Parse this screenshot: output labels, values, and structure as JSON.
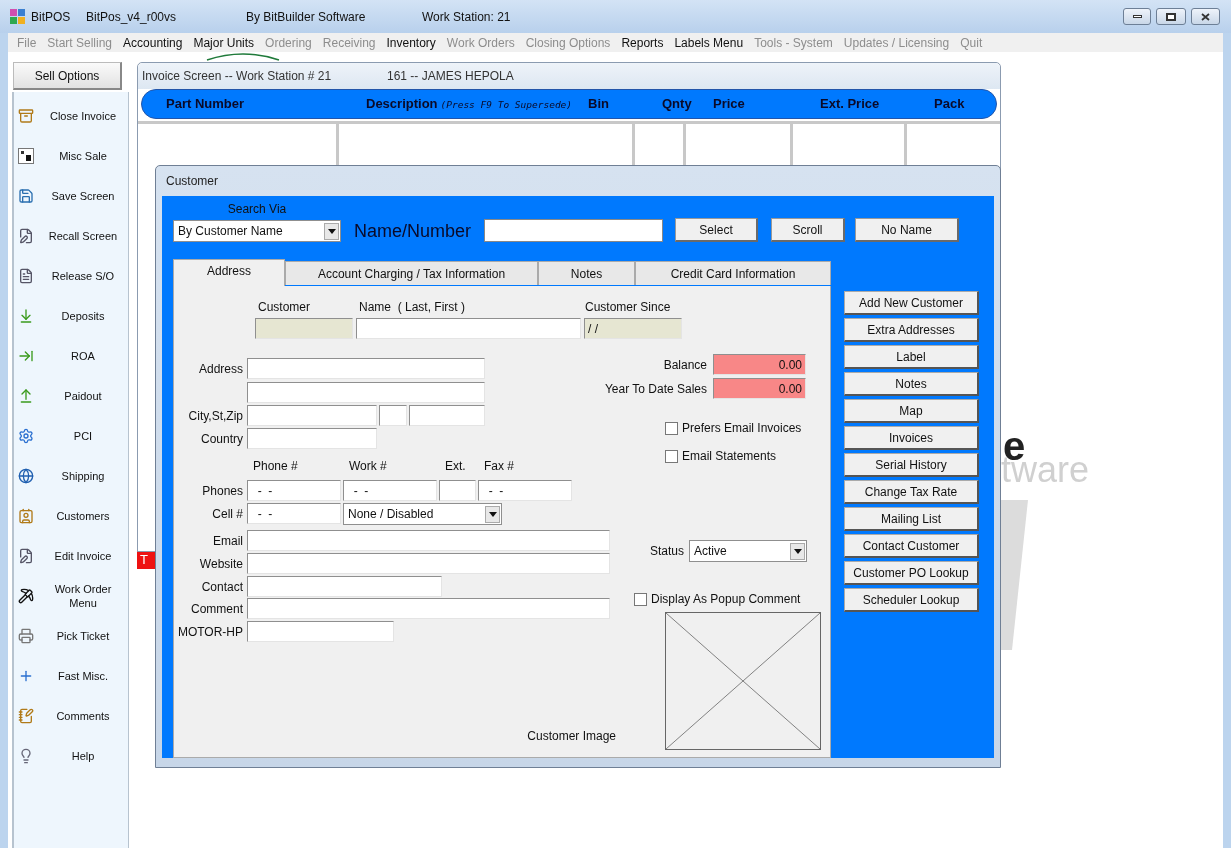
{
  "app_window": {
    "app_name": "BitPOS",
    "version": "BitPos_v4_r00vs",
    "vendor": "By BitBuilder Software",
    "workstation": "Work Station: 21"
  },
  "menu": [
    {
      "label": "File",
      "disabled": true
    },
    {
      "label": "Start Selling",
      "disabled": true
    },
    {
      "label": "Accounting",
      "disabled": false
    },
    {
      "label": "Major Units",
      "disabled": false
    },
    {
      "label": "Ordering",
      "disabled": true
    },
    {
      "label": "Receiving",
      "disabled": true
    },
    {
      "label": "Inventory",
      "disabled": false
    },
    {
      "label": "Work Orders",
      "disabled": true
    },
    {
      "label": "Closing Options",
      "disabled": true
    },
    {
      "label": "Reports",
      "disabled": false
    },
    {
      "label": "Labels Menu",
      "disabled": false
    },
    {
      "label": "Tools - System",
      "disabled": true
    },
    {
      "label": "Updates / Licensing",
      "disabled": true
    },
    {
      "label": "Quit",
      "disabled": true
    }
  ],
  "sidebar": {
    "header": "Sell Options",
    "items": [
      "Close Invoice",
      "Misc Sale",
      "Save Screen",
      "Recall Screen",
      "Release S/O",
      "Deposits",
      "ROA",
      "Paidout",
      "PCI",
      "Shipping",
      "Customers",
      "Edit Invoice",
      "Work Order Menu",
      "Pick Ticket",
      "Fast Misc.",
      "Comments",
      "Help"
    ]
  },
  "background": {
    "logo_text_1": "e",
    "logo_text_2": "tware",
    "tag": "T"
  },
  "invoice_window": {
    "title": "Invoice Screen -- Work Station # 21",
    "customer": "161 -- JAMES HEPOLA",
    "columns": [
      {
        "label": "Part Number"
      },
      {
        "label": "Description",
        "hint": "(Press F9 To Supersede)"
      },
      {
        "label": "Bin"
      },
      {
        "label": "Qnty"
      },
      {
        "label": "Price"
      },
      {
        "label": "Ext. Price"
      },
      {
        "label": "Pack"
      }
    ]
  },
  "customer_dialog": {
    "title": "Customer",
    "search_via_label": "Search Via",
    "search_via": "By Customer Name",
    "name_number_label": "Name/Number",
    "buttons": [
      "Select",
      "Scroll",
      "No Name"
    ],
    "tabs": [
      {
        "label": "Address",
        "selected": true
      },
      {
        "label": "Account Charging / Tax Information",
        "selected": false
      },
      {
        "label": "Notes",
        "selected": false
      },
      {
        "label": "Credit Card Information",
        "selected": false
      }
    ],
    "form": {
      "customer_label": "Customer",
      "name_label": "Name  ( Last, First )",
      "since_label": "Customer Since",
      "since_value": "/ /",
      "address_label": "Address",
      "city_label": "City,St,Zip",
      "country_label": "Country",
      "phone_headers": [
        "Phone #",
        "Work #",
        "Ext.",
        "Fax #"
      ],
      "phones_label": "Phones",
      "phone": "-  -",
      "work": "-  -",
      "fax": "-  -",
      "cell_label": "Cell #",
      "cell": "-  -",
      "cell_carrier": "None / Disabled",
      "email_label": "Email",
      "website_label": "Website",
      "contact_label": "Contact",
      "comment_label": "Comment",
      "custom_label": "MOTOR-HP",
      "image_label": "Customer Image",
      "balance_label": "Balance",
      "balance": "0.00",
      "ytd_label": "Year To Date Sales",
      "ytd": "0.00",
      "checkboxes": [
        {
          "label": "Prefers Email Invoices",
          "checked": false
        },
        {
          "label": "Email Statements",
          "checked": false
        }
      ],
      "status_label": "Status",
      "status": "Active",
      "popup": {
        "label": "Display As Popup Comment",
        "checked": false
      }
    },
    "actions": [
      "Add New Customer",
      "Extra Addresses",
      "Label",
      "Notes",
      "Map",
      "Invoices",
      "Serial History",
      "Change Tax Rate",
      "Mailing List",
      "Contact Customer",
      "Customer PO Lookup",
      "Scheduler Lookup"
    ]
  }
}
